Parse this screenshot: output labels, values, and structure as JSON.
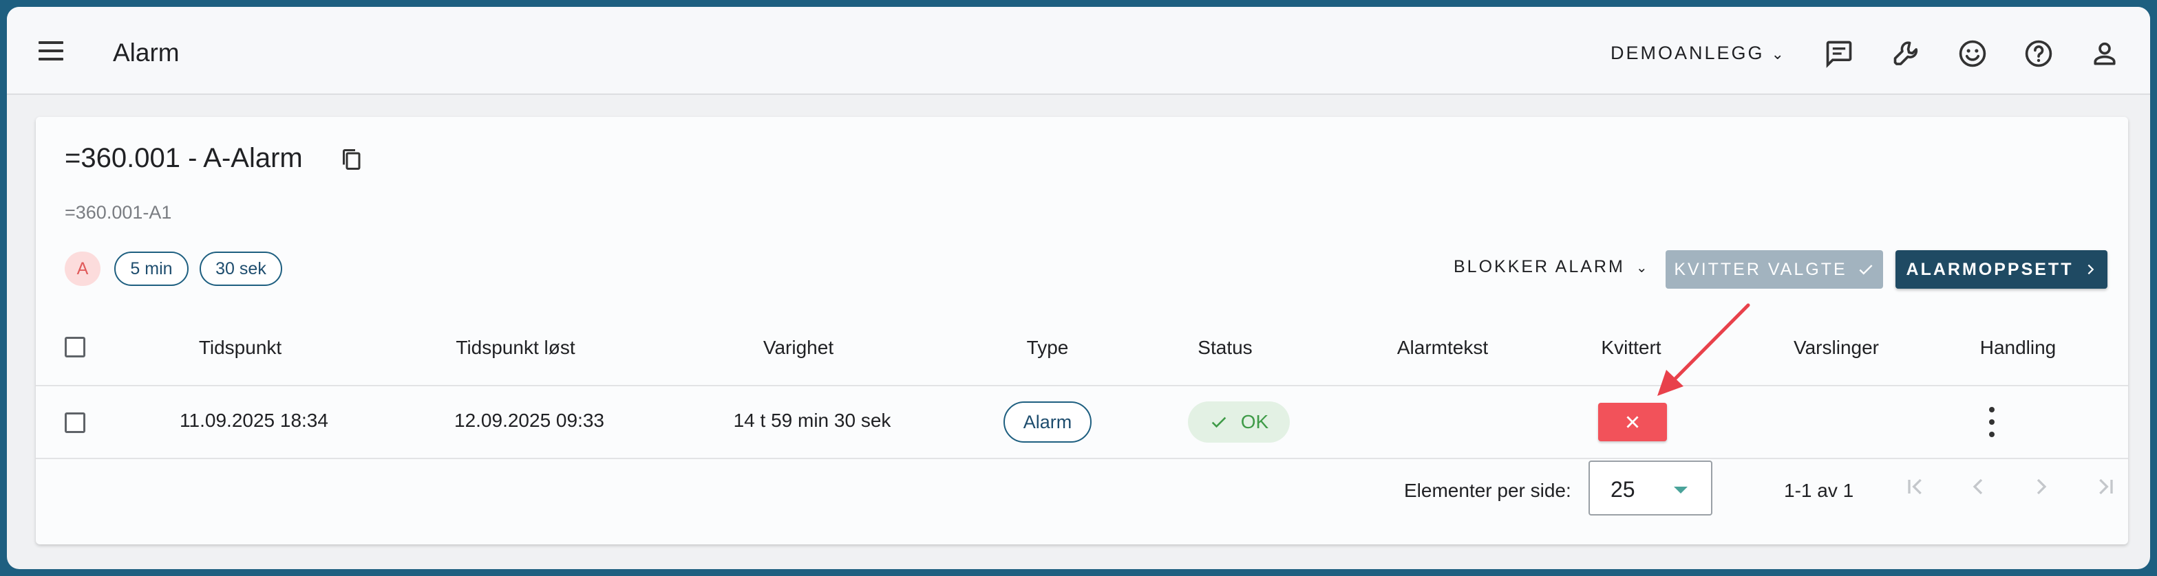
{
  "header": {
    "title": "Alarm",
    "site": "DEMOANLEGG",
    "icons": [
      "chat-icon",
      "wrench-icon",
      "smiley-icon",
      "help-icon",
      "account-icon"
    ]
  },
  "alarm": {
    "title": "=360.001 - A-Alarm",
    "subtitle": "=360.001-A1",
    "chips": {
      "priority": "A",
      "delay": "5 min",
      "repeat": "30 sek"
    }
  },
  "actions": {
    "block": "BLOKKER ALARM",
    "acknowledge_selected": "KVITTER VALGTE",
    "setup": "ALARMOPPSETT"
  },
  "table": {
    "columns": [
      "Tidspunkt",
      "Tidspunkt løst",
      "Varighet",
      "Type",
      "Status",
      "Alarmtekst",
      "Kvittert",
      "Varslinger",
      "Handling"
    ],
    "rows": [
      {
        "time": "11.09.2025 18:34",
        "resolved": "12.09.2025 09:33",
        "duration": "14 t 59 min 30 sek",
        "type": "Alarm",
        "status": "OK",
        "text": "",
        "acknowledged": false,
        "notifications": ""
      }
    ]
  },
  "pagination": {
    "per_page_label": "Elementer per side:",
    "per_page": "25",
    "range": "1-1 av 1"
  },
  "colors": {
    "frame": "#1e5f80",
    "primary": "#1f4a63",
    "disabled_button": "#a2b3bf",
    "ack_button": "#f2525a",
    "status_ok_bg": "#e3f1e4",
    "status_ok_text": "#3f9b48",
    "annotation_arrow": "#e8414b"
  }
}
